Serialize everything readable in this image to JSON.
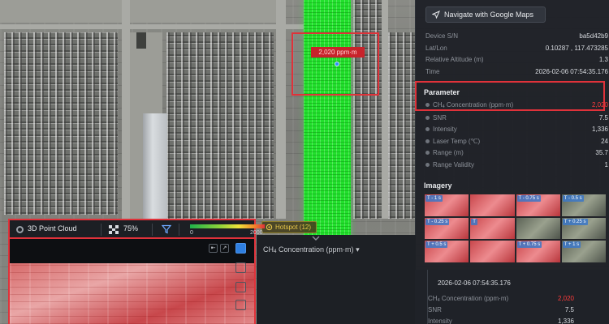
{
  "navigate_button": {
    "label": "Navigate with Google Maps",
    "icon": "navigation-arrow-icon"
  },
  "device_info": [
    {
      "key": "Device S/N",
      "value": "ba5d42b9"
    },
    {
      "key": "Lat/Lon",
      "value": "0.10287 ,  117.473285"
    },
    {
      "key": "Relative Altitude (m)",
      "value": "1.3"
    },
    {
      "key": "Time",
      "value": "2026-02-06 07:54:35.176"
    }
  ],
  "parameter": {
    "title": "Parameter",
    "ch4_label_prefix": "CH",
    "ch4_label_sub": "4",
    "ch4_label_suffix": " Concentration (ppm·m)",
    "ch4_value": "2,020",
    "rows": [
      {
        "key": "SNR",
        "value": "7.5"
      },
      {
        "key": "Intensity",
        "value": "1,336"
      },
      {
        "key": "Laser Temp (℃)",
        "value": "24"
      },
      {
        "key": "Range (m)",
        "value": "35.7"
      },
      {
        "key": "Range Validity",
        "value": "1"
      }
    ]
  },
  "imagery": {
    "title": "Imagery",
    "thumbnails": [
      {
        "label": "T - 1 s",
        "tone": "red"
      },
      {
        "label": "",
        "tone": "red"
      },
      {
        "label": "T - 0.75 s",
        "tone": "red"
      },
      {
        "label": "T - 0.5 s",
        "tone": "green"
      },
      {
        "label": "T - 0.25 s",
        "tone": "red"
      },
      {
        "label": "T",
        "tone": "red"
      },
      {
        "label": "",
        "tone": "green"
      },
      {
        "label": "T + 0.25 s",
        "tone": "green"
      },
      {
        "label": "T + 0.5 s",
        "tone": "red"
      },
      {
        "label": "",
        "tone": "red"
      },
      {
        "label": "T + 0.75 s",
        "tone": "red"
      },
      {
        "label": "T + 1 s",
        "tone": "green"
      }
    ]
  },
  "map": {
    "plume_label": "2,020 ppm·m",
    "hotspot_tag": "Hotspot (12)",
    "plume_color": "#22e02d",
    "highlight_color": "#e0323a"
  },
  "point_cloud": {
    "title": "3D Point Cloud",
    "opacity": "75%",
    "scale_min": "0",
    "scale_max": "2000"
  },
  "chart_selector": {
    "prefix": "CH",
    "sub": "4",
    "suffix": " Concentration (ppm·m)",
    "caret": "▾"
  },
  "detail": {
    "time": "2026-02-06 07:54:35.176",
    "ch4_value": "2,020",
    "snr_label": "SNR",
    "snr": "7.5",
    "intensity_label": "Intensity",
    "intensity": "1,336"
  }
}
